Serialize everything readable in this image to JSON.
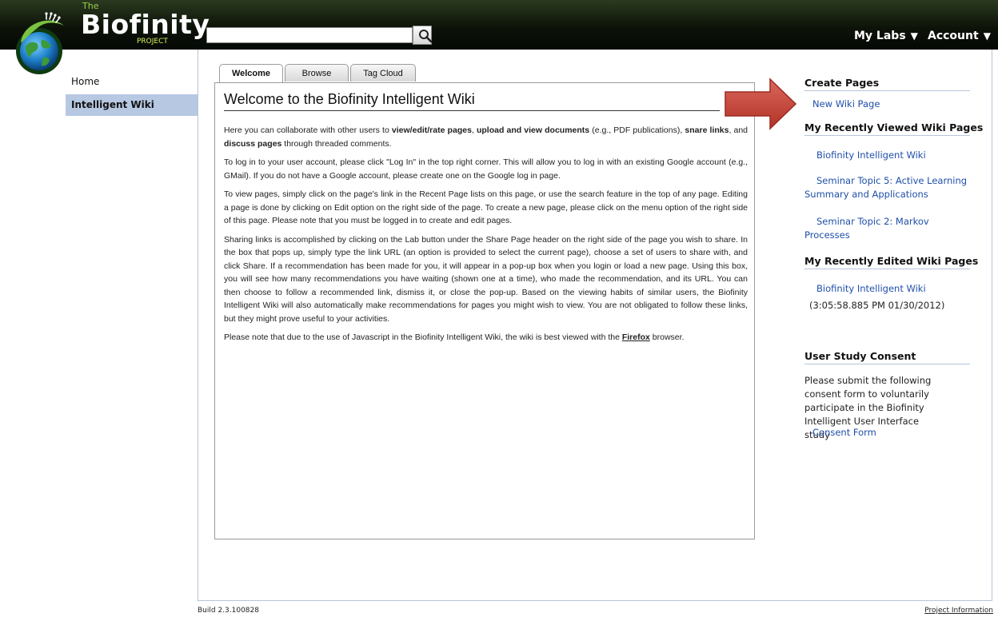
{
  "header": {
    "logo_the": "The",
    "logo_name": "Biofinity",
    "logo_project": "PROJECT",
    "search": {
      "value": "",
      "placeholder": "",
      "icon": "magnifier-icon"
    },
    "menus": [
      {
        "label": "My Labs",
        "caret": "▼"
      },
      {
        "label": "Account",
        "caret": "▼"
      }
    ]
  },
  "nav": {
    "items": [
      {
        "label": "Home",
        "active": false
      },
      {
        "label": "Intelligent Wiki",
        "active": true
      }
    ]
  },
  "tabs": [
    {
      "label": "Welcome",
      "active": true
    },
    {
      "label": "Browse",
      "active": false
    },
    {
      "label": "Tag Cloud",
      "active": false
    }
  ],
  "wiki": {
    "title": "Welcome to the Biofinity Intelligent Wiki",
    "p1": {
      "t1": "Here you can collaborate with other users to ",
      "b1": "view/edit/rate pages",
      "t2": ", ",
      "b2": "upload and view documents",
      "t3": " (e.g., PDF publications), ",
      "b3": "snare links",
      "t4": ", and ",
      "b4": "discuss pages",
      "t5": " through threaded comments."
    },
    "p2": "To log in to your user account, please click \"Log In\" in the top right corner. This will allow you to log in with an existing Google account (e.g., GMail). If you do not have a Google account, please create one on the Google log in page.",
    "p3": "To view pages, simply click on the page's link in the Recent Page lists on this page, or use the search feature in the top of any page. Editing a page is done by clicking on Edit option on the right side of the page. To create a new page, please click on the menu option of the right side of this page. Please note that you must be logged in to create and edit pages.",
    "p4": "Sharing links is accomplished by clicking on the Lab button under the Share Page header on the right side of the page you wish to share. In the box that pops up, simply type the link URL (an option is provided to select the current page), choose a set of users to share with, and click Share. If a recommendation has been made for you, it will appear in a pop-up box when you login or load a new page. Using this box, you will see how many recommendations you have waiting (shown one at a time), who made the recommendation, and its URL. You can then choose to follow a recommended link, dismiss it, or close the pop-up. Based on the viewing habits of similar users, the Biofinity Intelligent Wiki will also automatically make recommendations for pages you might wish to view. You are not obligated to follow these links, but they might prove useful to your activities.",
    "p5": {
      "t1": "Please note that due to the use of Javascript in the Biofinity Intelligent Wiki, the wiki is best viewed with the ",
      "link": "Firefox",
      "t2": " browser."
    }
  },
  "sidebar": {
    "create": {
      "heading": "Create Pages",
      "link": "New Wiki Page"
    },
    "viewed": {
      "heading": "My Recently Viewed Wiki Pages",
      "items": [
        {
          "line1": "Biofinity Intelligent Wiki",
          "line2": ""
        },
        {
          "line1": "Seminar Topic 5: Active Learning",
          "line2": "Summary and Applications"
        },
        {
          "line1": "Seminar Topic 2: Markov",
          "line2": "Processes"
        }
      ]
    },
    "edited": {
      "heading": "My Recently Edited Wiki Pages",
      "item": "Biofinity Intelligent Wiki",
      "timestamp": "(3:05:58.885 PM 01/30/2012)"
    },
    "consent": {
      "heading": "User Study Consent",
      "lines": [
        "Please submit the following",
        "consent form to voluntarily",
        "participate in the Biofinity",
        "Intelligent User Interface",
        "study"
      ],
      "link": "Consent Form"
    }
  },
  "footer": {
    "build": "Build 2.3.100828",
    "project_info": "Project Information"
  },
  "colors": {
    "header_bg": "#0d1309",
    "accent_green": "#9ad04a",
    "nav_active_bg": "#b7c8e2",
    "link_blue": "#1f4fa8",
    "arrow_red": "#c9423a"
  }
}
